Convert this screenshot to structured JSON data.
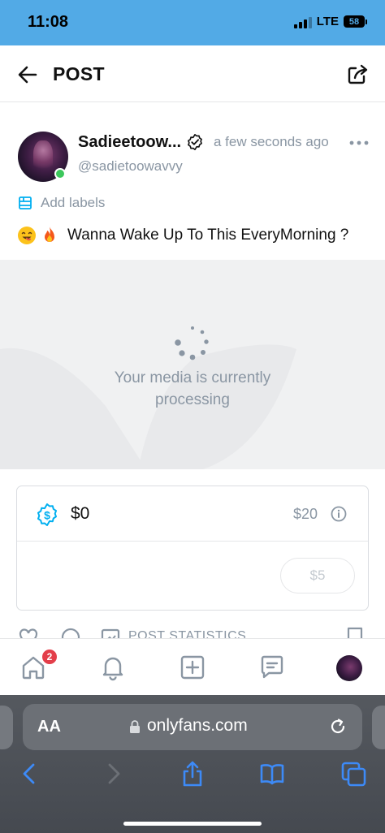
{
  "status_bar": {
    "time": "11:08",
    "network": "LTE",
    "battery": "58"
  },
  "header": {
    "title": "POST"
  },
  "author": {
    "name": "Sadieetoow...",
    "handle": "@sadietoowavvy",
    "time_ago": "a few seconds ago",
    "online": true
  },
  "labels": {
    "text": "Add labels"
  },
  "post": {
    "emojis": [
      "smile-emoji",
      "fire-emoji"
    ],
    "caption": "Wanna Wake Up To This EveryMorning ?"
  },
  "media": {
    "status_line1": "Your media is currently",
    "status_line2": "processing"
  },
  "tip": {
    "amount": "$0",
    "max": "$20",
    "button": "$5"
  },
  "actions": {
    "stats_label": "POST STATISTICS"
  },
  "bottom_nav": {
    "notification_count": "2",
    "items": [
      "home-icon",
      "bell-icon",
      "add-post-icon",
      "messages-icon",
      "profile-avatar"
    ]
  },
  "browser": {
    "aa_label": "AA",
    "url": "onlyfans.com"
  },
  "colors": {
    "accent": "#00aff0",
    "status_bar": "#52aae6",
    "muted": "#8a96a3",
    "badge": "#e33e4a",
    "browser_blue": "#3d8af7"
  }
}
